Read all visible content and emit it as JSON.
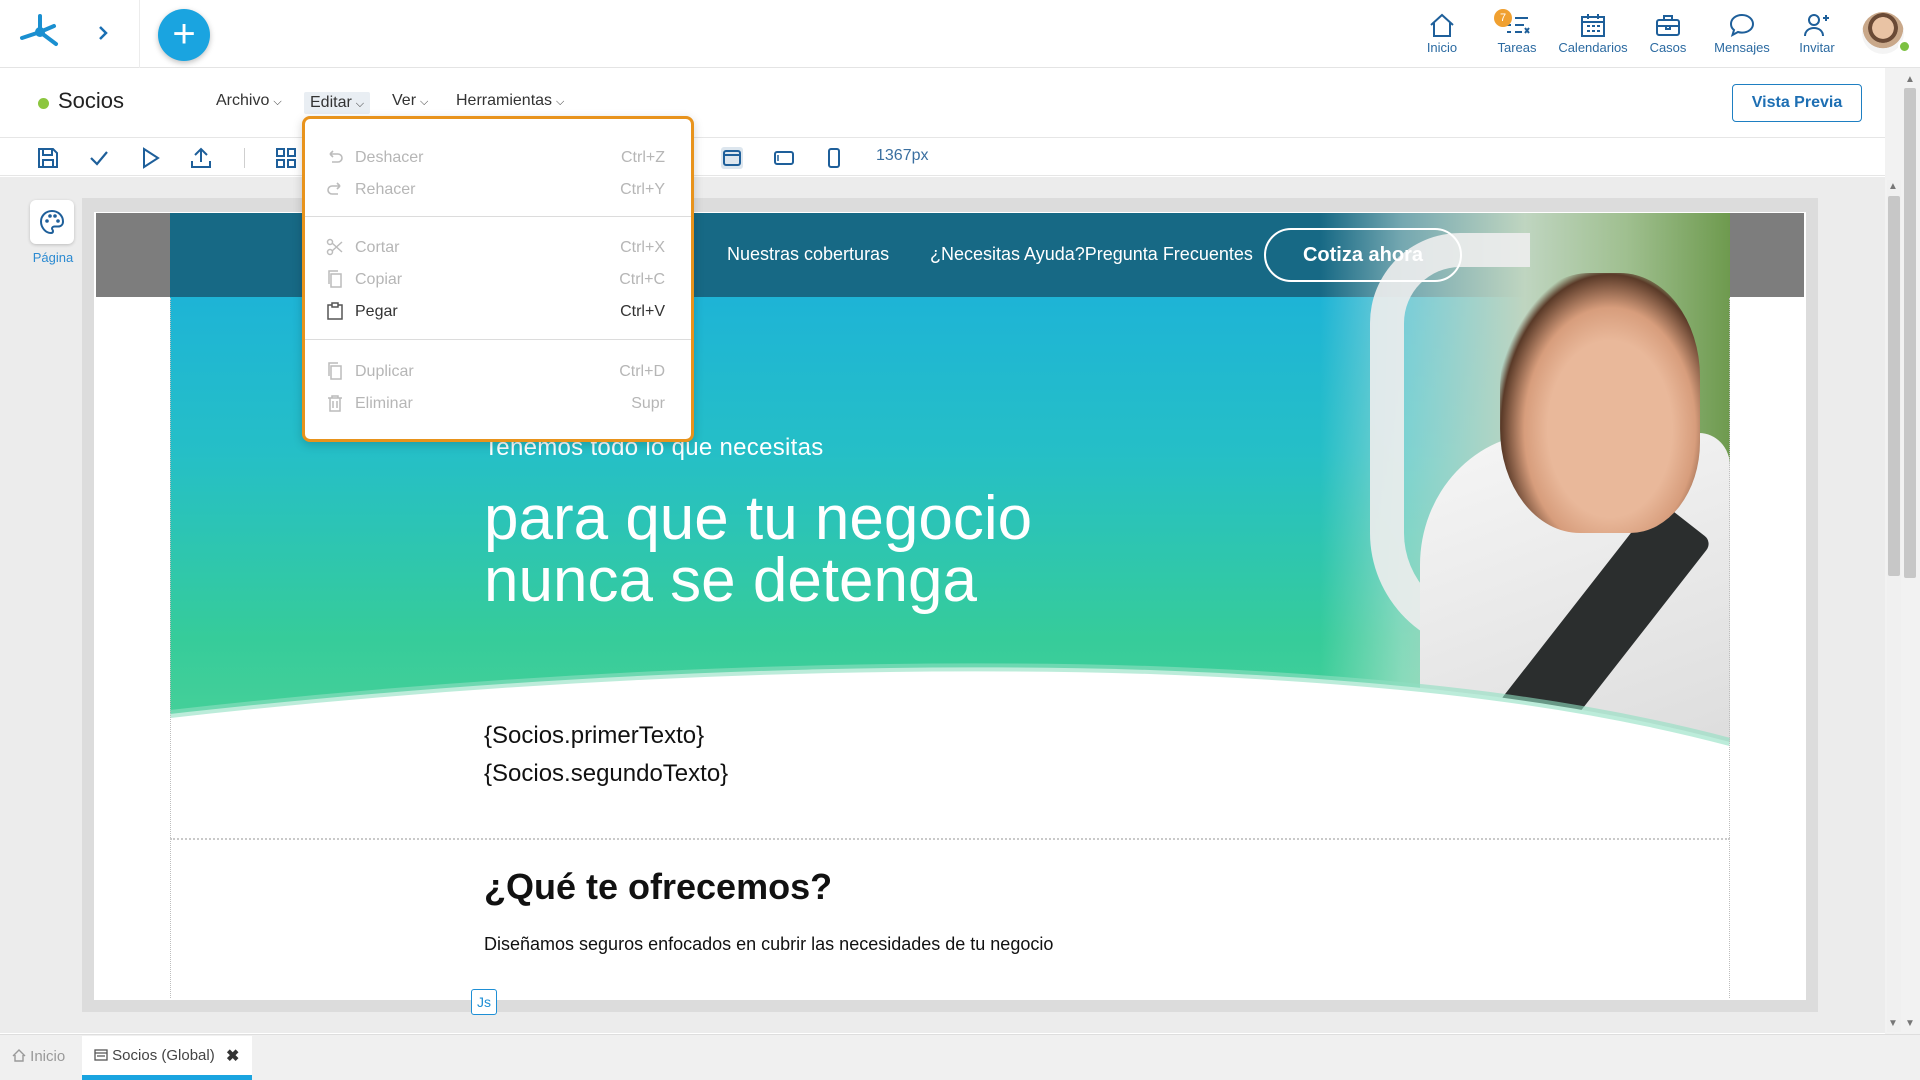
{
  "topnav": {
    "items": [
      {
        "label": "Inicio",
        "icon": "home-icon"
      },
      {
        "label": "Tareas",
        "icon": "tasks-icon"
      },
      {
        "label": "Calendarios",
        "icon": "calendar-icon"
      },
      {
        "label": "Casos",
        "icon": "briefcase-icon"
      },
      {
        "label": "Mensajes",
        "icon": "chat-icon"
      },
      {
        "label": "Invitar",
        "icon": "invite-user-icon"
      }
    ],
    "tasks_badge": "7",
    "add_symbol": "+"
  },
  "document": {
    "title": "Socios",
    "status_color": "#8cc63f",
    "menus": [
      "Archivo",
      "Editar",
      "Ver",
      "Herramientas"
    ],
    "preview_button": "Vista Previa",
    "width_label": "1367px"
  },
  "left_panel": {
    "page_tool_label": "Página"
  },
  "edit_menu": {
    "groups": [
      [
        {
          "label": "Deshacer",
          "shortcut": "Ctrl+Z",
          "enabled": false
        },
        {
          "label": "Rehacer",
          "shortcut": "Ctrl+Y",
          "enabled": false
        }
      ],
      [
        {
          "label": "Cortar",
          "shortcut": "Ctrl+X",
          "enabled": false
        },
        {
          "label": "Copiar",
          "shortcut": "Ctrl+C",
          "enabled": false
        },
        {
          "label": "Pegar",
          "shortcut": "Ctrl+V",
          "enabled": true
        }
      ],
      [
        {
          "label": "Duplicar",
          "shortcut": "Ctrl+D",
          "enabled": false
        },
        {
          "label": "Eliminar",
          "shortcut": "Supr",
          "enabled": false
        }
      ]
    ]
  },
  "site": {
    "nav": [
      "Nuestras coberturas",
      "¿Necesitas Ayuda?Pregunta Frecuentes"
    ],
    "cta": "Cotiza ahora",
    "hero_subtitle": "Tenemos todo lo que necesitas",
    "hero_title": "para que tu negocio nunca se detenga",
    "placeholder_1": "{Socios.primerTexto}",
    "placeholder_2": "{Socios.segundoTexto}",
    "offer_title": "¿Qué te ofrecemos?",
    "offer_text": "Diseñamos seguros enfocados en cubrir las necesidades de tu negocio",
    "js_badge": "Js"
  },
  "bottom_tabs": {
    "home": "Inicio",
    "active": "Socios (Global)",
    "close_symbol": "✖"
  },
  "colors": {
    "accent": "#1aa4e0",
    "menu_highlight": "#e8931c"
  }
}
